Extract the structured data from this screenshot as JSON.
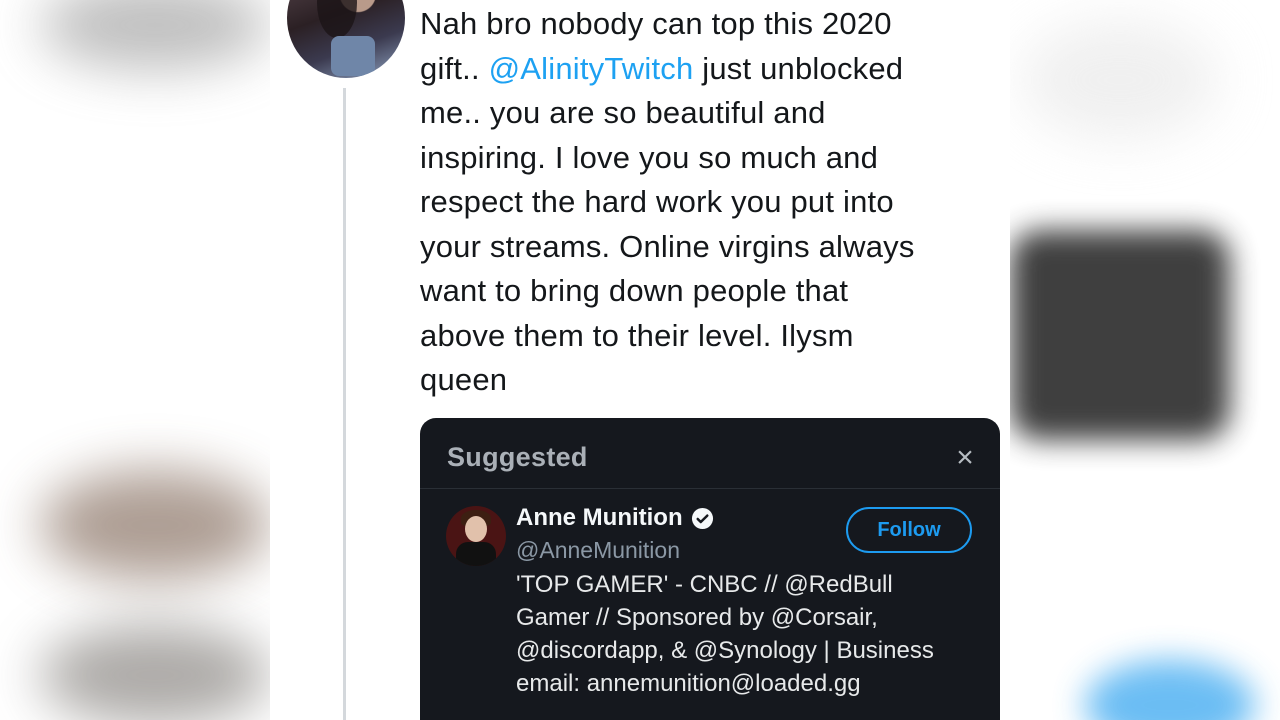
{
  "tweet": {
    "text_lines": [
      "Nah bro nobody can top this 2020",
      "gift.. ",
      "@AlinityTwitch",
      " just unblocked",
      "me.. you are so beautiful and",
      "inspiring. I love you so much and",
      "respect the hard work you put into",
      "your streams. Online virgins always",
      "want to bring down people that",
      "above them to their level. Ilysm",
      "queen"
    ],
    "mention_color": "#1da1f2"
  },
  "card": {
    "title": "Suggested",
    "close_icon": "×",
    "account": {
      "name": "Anne Munition",
      "handle": "@AnneMunition",
      "verified": true,
      "follow_label": "Follow",
      "bio_lines": [
        "'TOP GAMER' - CNBC // @RedBull",
        "Gamer // Sponsored by @Corsair,",
        "@discordapp, & @Synology | Business",
        "email: annemunition@loaded.gg"
      ]
    },
    "colors": {
      "background": "#15181e",
      "accent": "#1d9bf0"
    }
  }
}
